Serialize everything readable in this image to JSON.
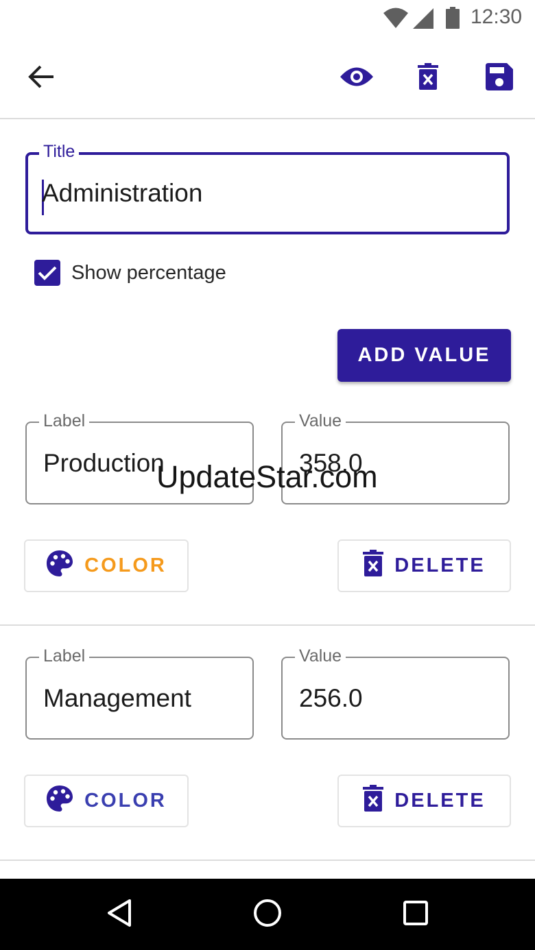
{
  "status_bar": {
    "time": "12:30",
    "icons": [
      "wifi-icon",
      "cell-signal-icon",
      "battery-icon"
    ]
  },
  "toolbar": {
    "actions": [
      "back-arrow-icon",
      "eye-icon",
      "delete-icon",
      "save-icon"
    ]
  },
  "title_field": {
    "label": "Title",
    "value": "Administration"
  },
  "show_percentage": {
    "label": "Show percentage",
    "checked": true
  },
  "add_value_button": {
    "label": "ADD VALUE"
  },
  "entries": [
    {
      "label_field": {
        "label": "Label",
        "value": "Production"
      },
      "value_field": {
        "label": "Value",
        "value": "358.0"
      },
      "color_button": {
        "label": "COLOR",
        "label_color": "#f59a1c"
      },
      "delete_button": {
        "label": "DELETE"
      }
    },
    {
      "label_field": {
        "label": "Label",
        "value": "Management"
      },
      "value_field": {
        "label": "Value",
        "value": "256.0"
      },
      "color_button": {
        "label": "COLOR",
        "label_color": "#3a3fb0"
      },
      "delete_button": {
        "label": "DELETE"
      }
    }
  ],
  "watermark": "UpdateStar.com",
  "nav_bar": {
    "buttons": [
      "back-triangle-icon",
      "home-circle-icon",
      "recents-square-icon"
    ]
  },
  "colors": {
    "primary": "#2e1c9a",
    "divider": "#dcdcdc",
    "outline": "#8a8a8a"
  }
}
